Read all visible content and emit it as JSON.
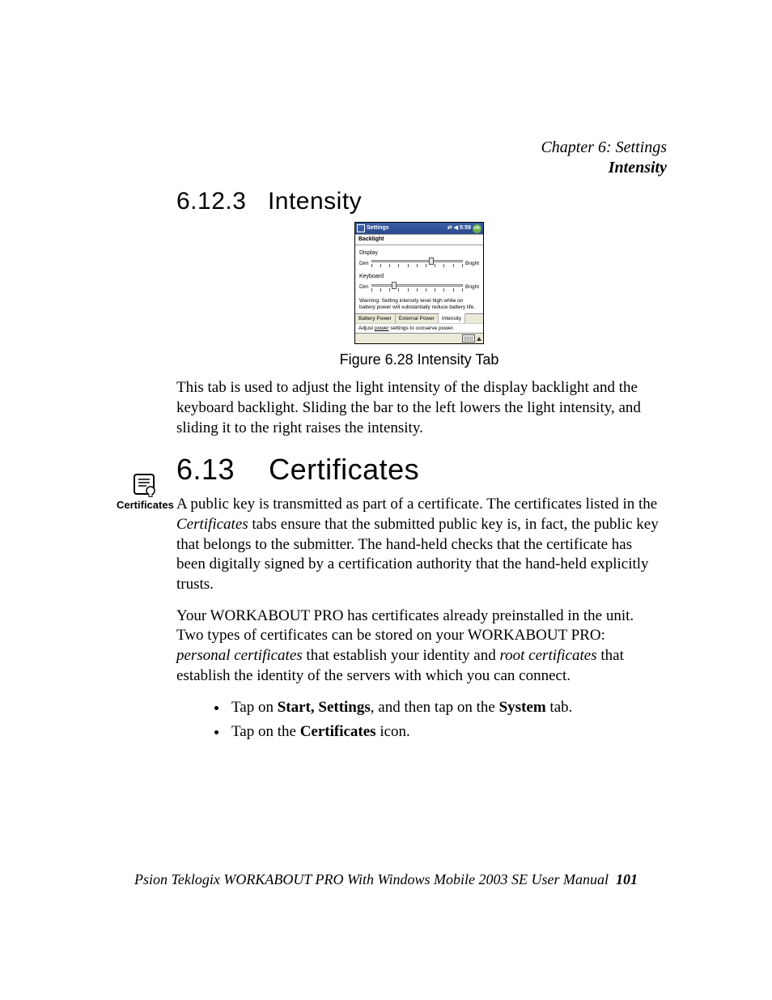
{
  "header": {
    "chapter": "Chapter 6: Settings",
    "section": "Intensity"
  },
  "h_sub_num": "6.12.3",
  "h_sub_title": "Intensity",
  "figure_caption": "Figure 6.28 Intensity Tab",
  "para_intensity": "This tab is used to adjust the light intensity of the display backlight and the keyboard backlight. Sliding the bar to the left lowers the light intensity, and sliding it to the right raises the intensity.",
  "h_main_num": "6.13",
  "h_main_title": "Certificates",
  "side_icon_label": "Certificates",
  "para_cert_1_a": "A public key is transmitted as part of a certificate. The certificates listed in the ",
  "para_cert_1_em": "Certificates",
  "para_cert_1_b": " tabs ensure that the submitted public key is, in fact, the public key that belongs to the submitter. The hand-held checks that the certificate has been digitally signed by a certification authority that the hand-held explicitly trusts.",
  "para_cert_2_a": "Your WORKABOUT PRO has certificates already preinstalled in the unit. Two types of certificates can be stored on your WORKABOUT PRO: ",
  "para_cert_2_em1": "personal certificates",
  "para_cert_2_b": " that establish your identity and ",
  "para_cert_2_em2": "root certificates",
  "para_cert_2_c": " that establish the identity of the servers with which you can connect.",
  "bullets": {
    "b1_a": "Tap on ",
    "b1_strong": "Start, Settings",
    "b1_b": ", and then tap on the ",
    "b1_strong2": "System",
    "b1_c": " tab.",
    "b2_a": "Tap on the ",
    "b2_strong": "Certificates",
    "b2_b": " icon."
  },
  "footer": {
    "text": "Psion Teklogix WORKABOUT PRO With Windows Mobile 2003 SE User Manual",
    "page": "101"
  },
  "device": {
    "top_title": "Settings",
    "top_time": "5:59",
    "ok": "ok",
    "title": "Backlight",
    "display_label": "Display",
    "keyboard_label": "Keyboard",
    "dim": "Dim",
    "bright": "Bright",
    "warning": "Warning: Setting intensity level high while on battery power will substantially reduce battery life.",
    "tabs": [
      "Battery Power",
      "External Power",
      "Intensity"
    ],
    "link_a": "Adjust ",
    "link_u": "power",
    "link_b": " settings to conserve power.",
    "display_slider_percent": 63,
    "keyboard_slider_percent": 22
  }
}
